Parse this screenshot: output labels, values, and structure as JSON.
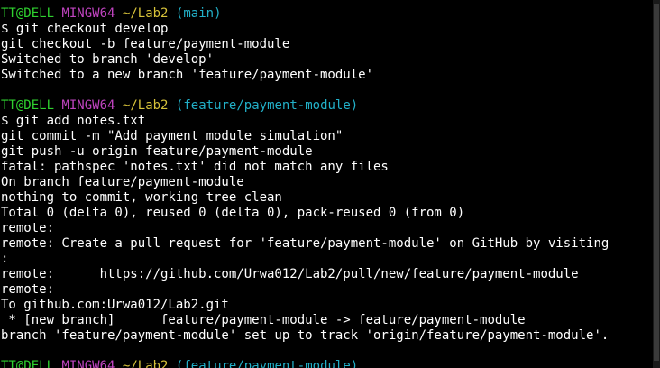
{
  "prompts": [
    {
      "user": "TT@DELL",
      "host": "MINGW64",
      "path": "~/Lab2",
      "branch": "(main)"
    },
    {
      "user": "TT@DELL",
      "host": "MINGW64",
      "path": "~/Lab2",
      "branch": "(feature/payment-module)"
    },
    {
      "user": "TT@DELL",
      "host": "MINGW64",
      "path": "~/Lab2",
      "branch": "(feature/payment-module)"
    }
  ],
  "block1": [
    "$ git checkout develop",
    "git checkout -b feature/payment-module",
    "Switched to branch 'develop'",
    "Switched to a new branch 'feature/payment-module'"
  ],
  "block2": [
    "$ git add notes.txt",
    "git commit -m \"Add payment module simulation\"",
    "git push -u origin feature/payment-module",
    "fatal: pathspec 'notes.txt' did not match any files",
    "On branch feature/payment-module",
    "nothing to commit, working tree clean",
    "Total 0 (delta 0), reused 0 (delta 0), pack-reused 0 (from 0)",
    "remote:",
    "remote: Create a pull request for 'feature/payment-module' on GitHub by visiting",
    ":",
    "remote:      https://github.com/Urwa012/Lab2/pull/new/feature/payment-module",
    "remote:",
    "To github.com:Urwa012/Lab2.git",
    " * [new branch]      feature/payment-module -> feature/payment-module",
    "branch 'feature/payment-module' set up to track 'origin/feature/payment-module'."
  ],
  "colors": {
    "background": "#000000",
    "text": "#ffffff",
    "user": "#2fd12f",
    "host": "#c044c0",
    "path": "#d7c23a",
    "branch": "#22b0c8"
  }
}
